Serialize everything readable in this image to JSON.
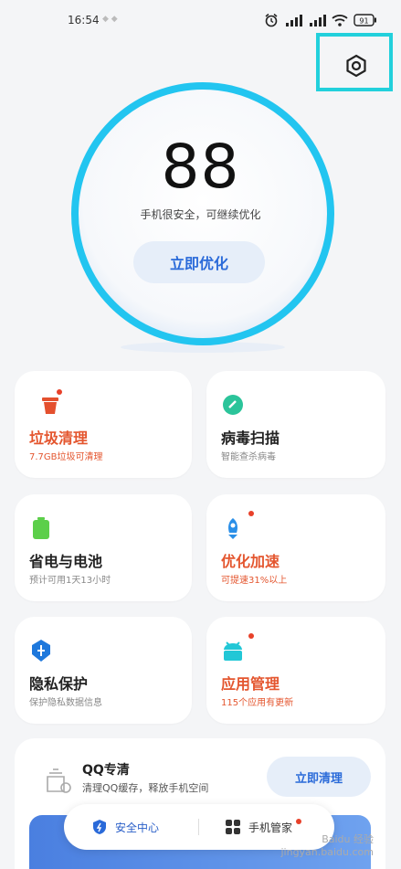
{
  "status_bar": {
    "time": "16:54",
    "battery_level": "91"
  },
  "score": {
    "value": "88",
    "message": "手机很安全，可继续优化",
    "button_label": "立即优化"
  },
  "cards": [
    {
      "title": "垃圾清理",
      "subtitle": "7.7GB垃圾可清理",
      "icon": "trash-icon",
      "icon_color": "#e4502e",
      "badge": true,
      "warn": true
    },
    {
      "title": "病毒扫描",
      "subtitle": "智能查杀病毒",
      "icon": "shield-scan-icon",
      "icon_color": "#2bc49a",
      "badge": false,
      "warn": false
    },
    {
      "title": "省电与电池",
      "subtitle": "预计可用1天13小时",
      "icon": "battery-icon",
      "icon_color": "#5ccf4a",
      "badge": false,
      "warn": false
    },
    {
      "title": "优化加速",
      "subtitle": "可提速31%以上",
      "icon": "rocket-icon",
      "icon_color": "#2a8fe8",
      "badge": true,
      "warn": true
    },
    {
      "title": "隐私保护",
      "subtitle": "保护隐私数据信息",
      "icon": "privacy-shield-icon",
      "icon_color": "#1e78dc",
      "badge": false,
      "warn": false
    },
    {
      "title": "应用管理",
      "subtitle": "115个应用有更新",
      "icon": "android-icon",
      "icon_color": "#22c7d6",
      "badge": true,
      "warn": true
    }
  ],
  "qq": {
    "title": "QQ专清",
    "subtitle": "清理QQ缓存，释放手机空间",
    "button_label": "立即清理"
  },
  "bottom_nav": {
    "security_center": "安全中心",
    "phone_manager": "手机管家"
  },
  "colors": {
    "accent": "#2a6ad9",
    "ring": "#22c5f0",
    "highlight": "#22d0dc",
    "warn": "#e4562f"
  },
  "watermark": {
    "brand": "Baidu 经验",
    "url": "jingyan.baidu.com"
  }
}
